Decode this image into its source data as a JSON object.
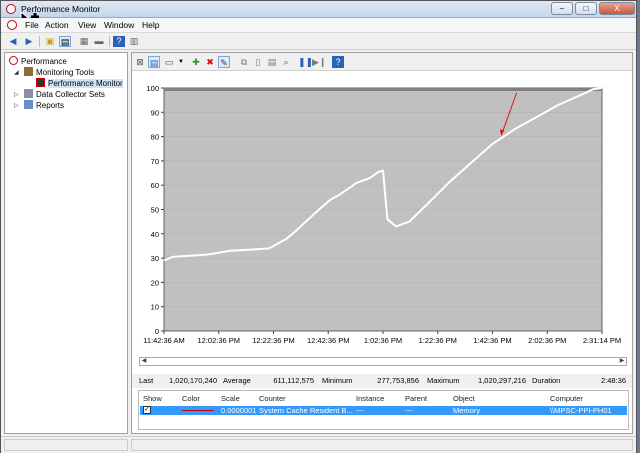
{
  "window": {
    "title": "Performance Monitor",
    "minimize": "–",
    "maximize": "□",
    "close": "X"
  },
  "menu": [
    "File",
    "Action",
    "View",
    "Window",
    "Help"
  ],
  "tree": {
    "root": "Performance",
    "monitoring_tools": "Monitoring Tools",
    "performance_monitor": "Performance Monitor",
    "data_collector_sets": "Data Collector Sets",
    "reports": "Reports"
  },
  "stats": {
    "last_label": "Last",
    "last_value": "1,020,170,240",
    "average_label": "Average",
    "average_value": "611,112,575",
    "minimum_label": "Minimum",
    "minimum_value": "277,753,856",
    "maximum_label": "Maximum",
    "maximum_value": "1,020,297,216",
    "duration_label": "Duration",
    "duration_value": "2:48:36"
  },
  "legend": {
    "headers": {
      "show": "Show",
      "color": "Color",
      "scale": "Scale",
      "counter": "Counter",
      "instance": "Instance",
      "parent": "Parent",
      "object": "Object",
      "computer": "Computer"
    },
    "row": {
      "scale": "0.0000001",
      "counter": "System Cache Resident B...",
      "instance": "---",
      "parent": "---",
      "object": "Memory",
      "computer": "\\\\MPSC-PPI-PH01",
      "line_color": "#cc0000"
    }
  },
  "chart_data": {
    "type": "line",
    "ylim": [
      0,
      100
    ],
    "yticks": [
      "0",
      "10",
      "20",
      "30",
      "40",
      "50",
      "60",
      "70",
      "80",
      "90",
      "100"
    ],
    "xticks": [
      "11:42:36 AM",
      "12:02:36 PM",
      "12:22:36 PM",
      "12:42:36 PM",
      "1:02:36 PM",
      "1:22:36 PM",
      "1:42:36 PM",
      "2:02:36 PM",
      "2:31:14 PM"
    ],
    "grid": true,
    "background": "#c0c0c0",
    "line_color": "#ffffff",
    "series": [
      {
        "x": [
          0,
          0.02,
          0.06,
          0.1,
          0.15,
          0.2,
          0.24,
          0.28,
          0.3,
          0.33,
          0.36,
          0.38,
          0.4,
          0.44,
          0.47,
          0.49,
          0.5,
          0.51,
          0.53,
          0.56,
          0.6,
          0.65,
          0.7,
          0.75,
          0.8,
          0.85,
          0.9,
          0.95,
          0.98,
          1.0
        ],
        "values": [
          29,
          30.5,
          31,
          31.5,
          33,
          33.5,
          34,
          38,
          41,
          46,
          51,
          54,
          56,
          61,
          63,
          65.5,
          66,
          46,
          43,
          45,
          52,
          61,
          69,
          77,
          83,
          88,
          93,
          97,
          99.5,
          100
        ]
      }
    ],
    "annotation": {
      "type": "arrow",
      "color": "#e01010"
    }
  },
  "icons": {
    "back": "back-arrow-icon",
    "forward": "forward-arrow-icon",
    "up": "up-folder-icon",
    "add": "add-icon",
    "delete": "delete-icon",
    "pause": "pause-icon",
    "help": "help-icon"
  }
}
